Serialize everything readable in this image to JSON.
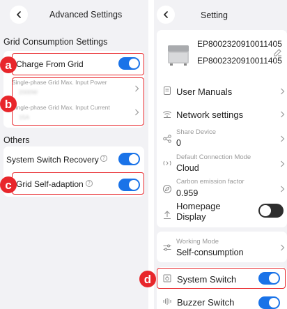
{
  "left": {
    "header": {
      "title": "Advanced Settings"
    },
    "grid_section_title": "Grid Consumption Settings",
    "charge_from_grid": {
      "label": "Charge From Grid",
      "on": true
    },
    "single_phase_power": {
      "label": "Single-phase Grid Max. Input Power",
      "value": "2000W"
    },
    "single_phase_current": {
      "label": "Single-phase Grid Max. Input Current",
      "value": "15A"
    },
    "others_title": "Others",
    "system_switch_recovery": {
      "label": "System Switch Recovery",
      "on": true
    },
    "grid_self_adaption": {
      "label": "Grid Self-adaption",
      "on": true
    }
  },
  "right": {
    "header": {
      "title": "Setting"
    },
    "device": {
      "name": "EP8002320910011405",
      "serial": "EP8002320910011405"
    },
    "user_manuals": "User Manuals",
    "network_settings": "Network settings",
    "share_device": {
      "label": "Share Device",
      "value": "0"
    },
    "default_connection": {
      "label": "Default Connection Mode",
      "value": "Cloud"
    },
    "carbon_factor": {
      "label": "Carbon emission factor",
      "value": "0.959"
    },
    "homepage_display": {
      "line1": "Homepage",
      "line2": "Display",
      "on": false
    },
    "working_mode": {
      "label": "Working Mode",
      "value": "Self-consumption"
    },
    "system_switch": {
      "label": "System Switch",
      "on": true
    },
    "buzzer_switch": {
      "label": "Buzzer Switch",
      "on": true
    }
  },
  "markers": {
    "a": "a",
    "b": "b",
    "c": "c",
    "d": "d"
  },
  "colors": {
    "accent": "#1a73e8",
    "highlight": "#e8262b",
    "background": "#f2f2f5"
  }
}
